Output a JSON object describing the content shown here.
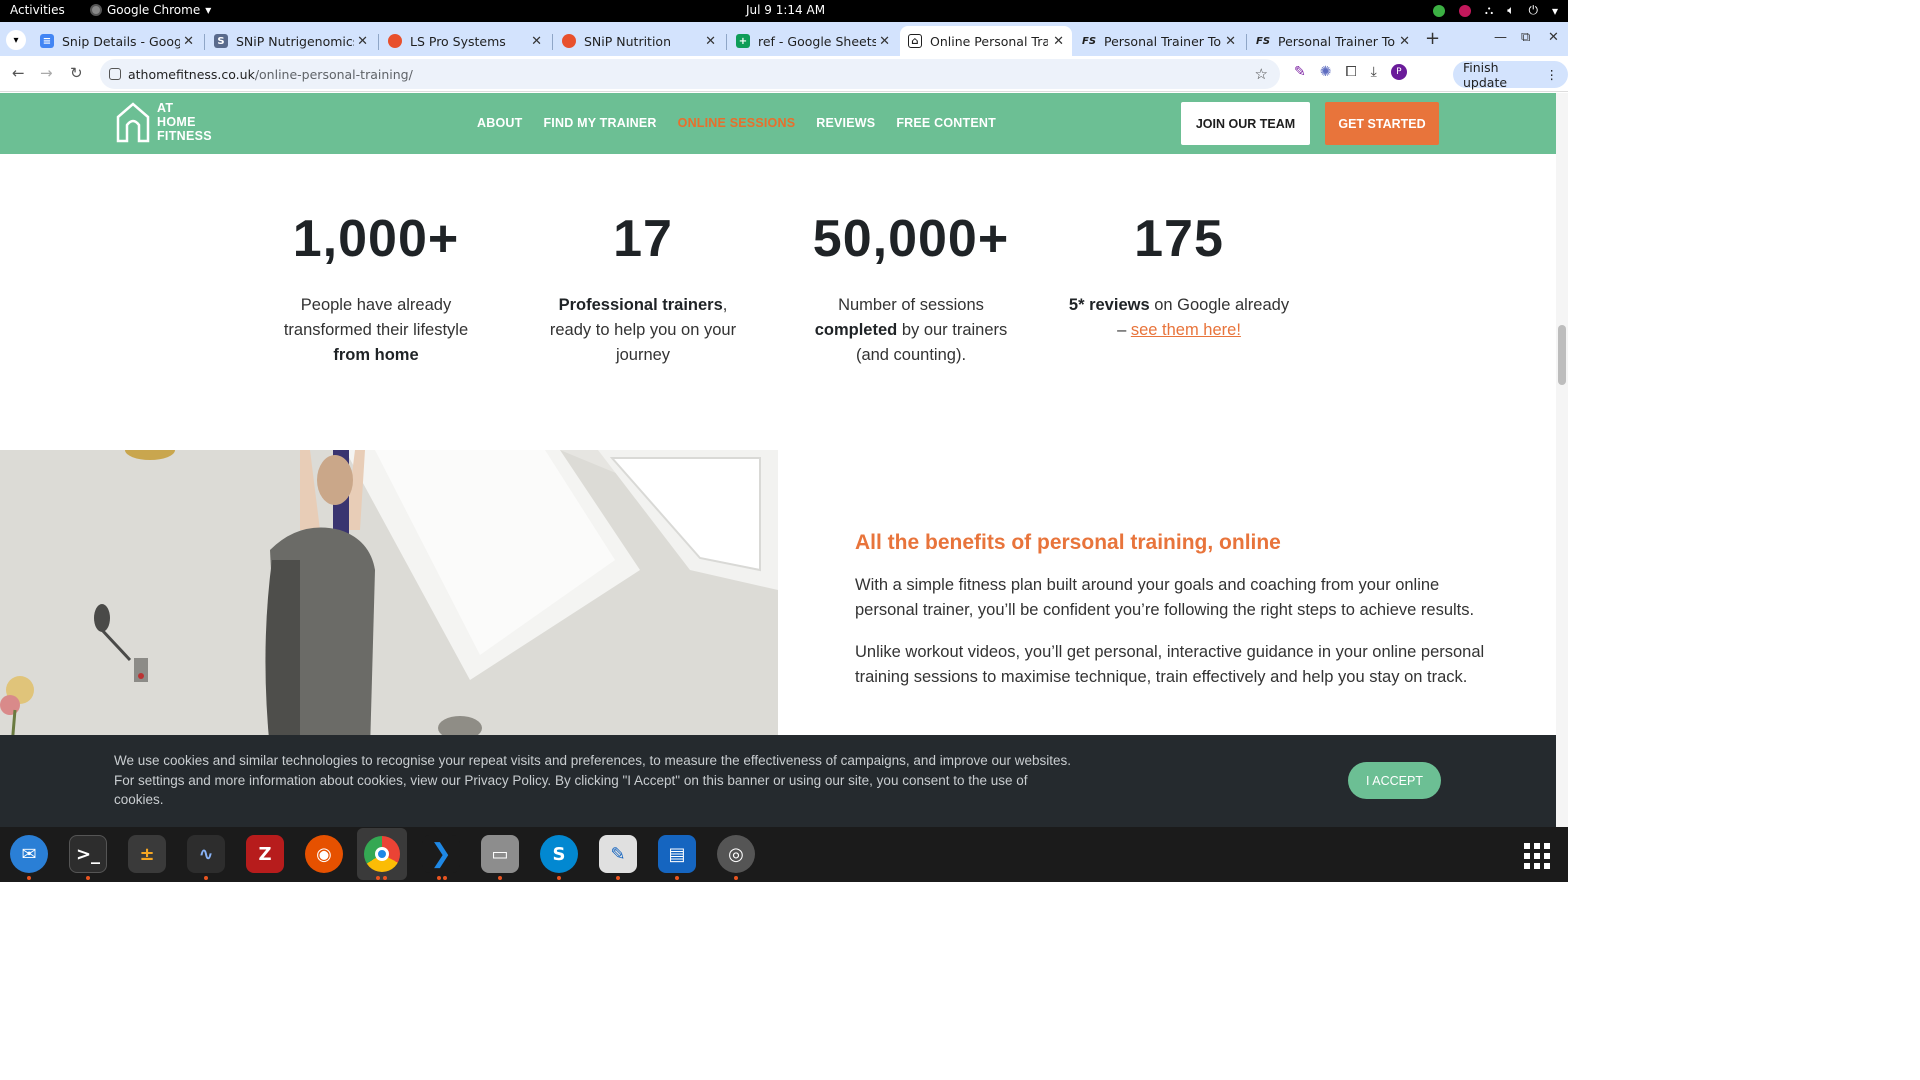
{
  "system": {
    "activities": "Activities",
    "app_name": "Google Chrome",
    "clock": "Jul 9  1:14 AM"
  },
  "tabs": [
    {
      "title": "Snip Details - Google",
      "favicon_color": "#4285f4",
      "favicon": "doc"
    },
    {
      "title": "SNiP Nutrigenomics",
      "favicon_color": "#5a6b8c",
      "favicon": "snip"
    },
    {
      "title": "LS Pro Systems",
      "favicon_color": "#e8502c",
      "favicon": "ls"
    },
    {
      "title": "SNiP Nutrition",
      "favicon_color": "#e8502c",
      "favicon": "snip2"
    },
    {
      "title": "ref - Google Sheets",
      "favicon_color": "#0f9d58",
      "favicon": "sheets"
    },
    {
      "title": "Online Personal Trai",
      "favicon_color": "#1f1f1f",
      "favicon": "athome"
    },
    {
      "title": "Personal Trainer Tor",
      "favicon_color": "#1f1f1f",
      "favicon": "fs"
    },
    {
      "title": "Personal Trainer Tor",
      "favicon_color": "#1f1f1f",
      "favicon": "fs"
    }
  ],
  "omnibox": {
    "domain": "athomefitness.co.uk",
    "path": "/online-personal-training/"
  },
  "toolbar": {
    "finish_update": "Finish update",
    "avatar_letter": "P"
  },
  "site": {
    "logo_lines": [
      "AT",
      "HOME",
      "FITNESS"
    ],
    "nav": [
      {
        "label": "ABOUT",
        "active": false
      },
      {
        "label": "FIND MY TRAINER",
        "active": false
      },
      {
        "label": "ONLINE SESSIONS",
        "active": true
      },
      {
        "label": "REVIEWS",
        "active": false
      },
      {
        "label": "FREE CONTENT",
        "active": false
      }
    ],
    "join_button": "JOIN OUR TEAM",
    "start_button": "GET STARTED",
    "colors": {
      "brand_green": "#6cbf94",
      "accent_orange": "#e8743b"
    }
  },
  "stats": [
    {
      "number": "1,000+",
      "pre": "People have already transformed their lifestyle ",
      "bold": "from home",
      "post": "",
      "link": ""
    },
    {
      "number": "17",
      "pre": "",
      "bold": "Professional trainers",
      "post": ", ready to help you on your journey",
      "link": ""
    },
    {
      "number": "50,000+",
      "pre": "Number of sessions ",
      "bold": "completed",
      "post": " by our trainers (and counting).",
      "link": ""
    },
    {
      "number": "175",
      "pre": "",
      "bold": "5* reviews",
      "post": " on Google already – ",
      "link": "see them here!"
    }
  ],
  "benefits": {
    "heading": "All the benefits of personal training, online",
    "p1": "With a simple fitness plan built around your goals and coaching from your online personal trainer, you’ll be confident you’re following the right steps to achieve results.",
    "p2": "Unlike workout videos, you’ll get personal, interactive guidance in your online personal training sessions to maximise technique, train effectively and help you stay on track."
  },
  "cookie": {
    "text": "We use cookies and similar technologies to recognise your repeat visits and preferences, to measure the effectiveness of campaigns, and improve our websites. For settings and more information about cookies, view our Privacy Policy. By clicking \"I Accept\" on this banner or using our site, you consent to the use of cookies.",
    "accept": "I ACCEPT"
  },
  "dock": [
    {
      "name": "thunderbird-icon",
      "color": "#2a7fd6",
      "active": false
    },
    {
      "name": "terminal-icon",
      "color": "#2d2d2d",
      "active": false
    },
    {
      "name": "calculator-icon",
      "color": "#3a3a3a",
      "active": false
    },
    {
      "name": "system-monitor-icon",
      "color": "#2d2d2d",
      "active": false
    },
    {
      "name": "filezilla-icon",
      "color": "#b71c1c",
      "active": false
    },
    {
      "name": "firefox-icon",
      "color": "#e65100",
      "active": false
    },
    {
      "name": "chrome-icon",
      "color": "#1e88e5",
      "active": true
    },
    {
      "name": "vscode-icon",
      "color": "#1976d2",
      "active": false
    },
    {
      "name": "files-icon",
      "color": "#8d8d8d",
      "active": false
    },
    {
      "name": "skype-icon",
      "color": "#0288d1",
      "active": false
    },
    {
      "name": "text-editor-icon",
      "color": "#e0e0e0",
      "active": false
    },
    {
      "name": "libreoffice-writer-icon",
      "color": "#1565c0",
      "active": false
    },
    {
      "name": "disk-icon",
      "color": "#555555",
      "active": false
    }
  ]
}
